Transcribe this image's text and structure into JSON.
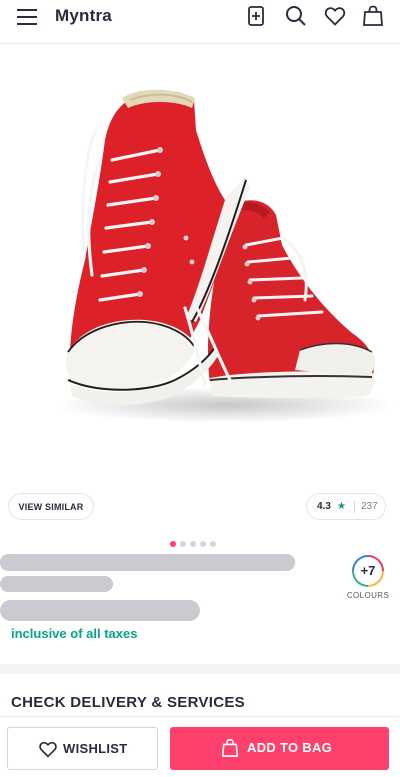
{
  "header": {
    "brand": "Myntra",
    "icons": [
      "menu-icon",
      "add-to-box-icon",
      "search-icon",
      "heart-icon",
      "bag-icon"
    ]
  },
  "product": {
    "image_subject": "red high-top canvas sneakers",
    "view_similar_label": "VIEW SIMILAR",
    "rating": "4.3",
    "rating_star": "★",
    "rating_count": "237",
    "carousel": {
      "total": 5,
      "active": 0
    },
    "colours_count": "+7",
    "colours_label": "COLOURS",
    "tax_note": "inclusive of all taxes"
  },
  "delivery": {
    "title": "CHECK DELIVERY & SERVICES"
  },
  "actions": {
    "wishlist_label": "WISHLIST",
    "add_to_bag_label": "ADD TO BAG"
  },
  "colors": {
    "accent": "#ff3f6c",
    "tax_green": "#03a685",
    "star_teal": "#14958f",
    "text": "#282c3f",
    "skeleton": "#c9cbd1"
  }
}
